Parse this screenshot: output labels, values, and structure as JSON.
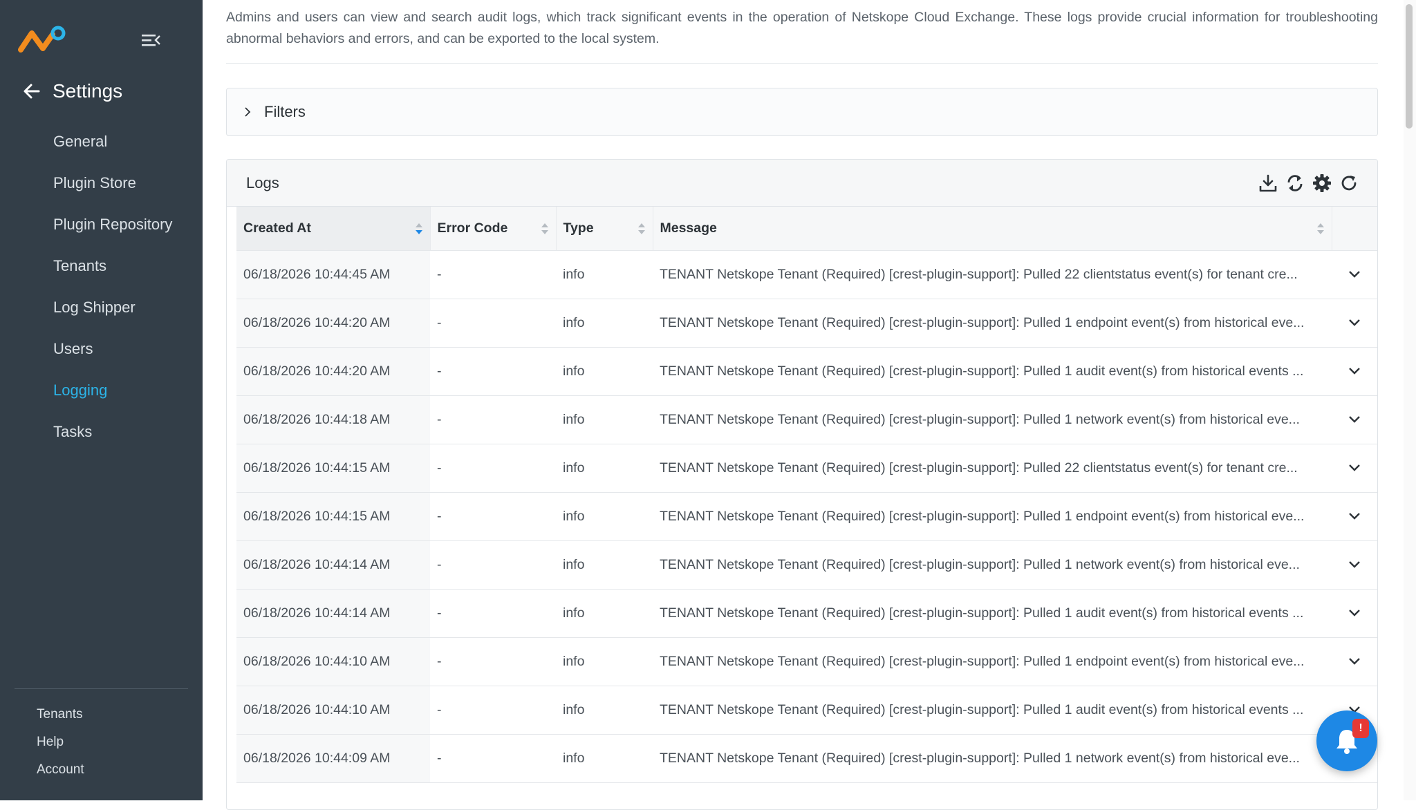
{
  "sidebar": {
    "settings_title": "Settings",
    "nav_items": [
      {
        "label": "General"
      },
      {
        "label": "Plugin Store"
      },
      {
        "label": "Plugin Repository"
      },
      {
        "label": "Tenants"
      },
      {
        "label": "Log Shipper"
      },
      {
        "label": "Users"
      },
      {
        "label": "Logging",
        "active": true
      },
      {
        "label": "Tasks"
      }
    ],
    "footer_items": [
      {
        "label": "Tenants"
      },
      {
        "label": "Help"
      },
      {
        "label": "Account"
      }
    ]
  },
  "description": "Admins and users can view and search audit logs, which track significant events in the operation of Netskope Cloud Exchange. These logs provide crucial information for troubleshooting abnormal behaviors and errors, and can be exported to the local system.",
  "filters": {
    "label": "Filters"
  },
  "logs": {
    "title": "Logs",
    "toolbar": [
      "download-icon",
      "sync-icon",
      "gear-icon",
      "refresh-icon"
    ],
    "columns": {
      "created_at": "Created At",
      "error_code": "Error Code",
      "type": "Type",
      "message": "Message"
    },
    "rows": [
      {
        "created_at": "06/18/2026 10:44:45 AM",
        "error_code": "-",
        "type": "info",
        "message": "TENANT Netskope Tenant (Required) [crest-plugin-support]: Pulled 22 clientstatus event(s) for tenant cre..."
      },
      {
        "created_at": "06/18/2026 10:44:20 AM",
        "error_code": "-",
        "type": "info",
        "message": "TENANT Netskope Tenant (Required) [crest-plugin-support]: Pulled 1 endpoint event(s) from historical eve..."
      },
      {
        "created_at": "06/18/2026 10:44:20 AM",
        "error_code": "-",
        "type": "info",
        "message": "TENANT Netskope Tenant (Required) [crest-plugin-support]: Pulled 1 audit event(s) from historical events ..."
      },
      {
        "created_at": "06/18/2026 10:44:18 AM",
        "error_code": "-",
        "type": "info",
        "message": "TENANT Netskope Tenant (Required) [crest-plugin-support]: Pulled 1 network event(s) from historical eve..."
      },
      {
        "created_at": "06/18/2026 10:44:15 AM",
        "error_code": "-",
        "type": "info",
        "message": "TENANT Netskope Tenant (Required) [crest-plugin-support]: Pulled 22 clientstatus event(s) for tenant cre..."
      },
      {
        "created_at": "06/18/2026 10:44:15 AM",
        "error_code": "-",
        "type": "info",
        "message": "TENANT Netskope Tenant (Required) [crest-plugin-support]: Pulled 1 endpoint event(s) from historical eve..."
      },
      {
        "created_at": "06/18/2026 10:44:14 AM",
        "error_code": "-",
        "type": "info",
        "message": "TENANT Netskope Tenant (Required) [crest-plugin-support]: Pulled 1 network event(s) from historical eve..."
      },
      {
        "created_at": "06/18/2026 10:44:14 AM",
        "error_code": "-",
        "type": "info",
        "message": "TENANT Netskope Tenant (Required) [crest-plugin-support]: Pulled 1 audit event(s) from historical events ..."
      },
      {
        "created_at": "06/18/2026 10:44:10 AM",
        "error_code": "-",
        "type": "info",
        "message": "TENANT Netskope Tenant (Required) [crest-plugin-support]: Pulled 1 endpoint event(s) from historical eve..."
      },
      {
        "created_at": "06/18/2026 10:44:10 AM",
        "error_code": "-",
        "type": "info",
        "message": "TENANT Netskope Tenant (Required) [crest-plugin-support]: Pulled 1 audit event(s) from historical events ..."
      },
      {
        "created_at": "06/18/2026 10:44:09 AM",
        "error_code": "-",
        "type": "info",
        "message": "TENANT Netskope Tenant (Required) [crest-plugin-support]: Pulled 1 network event(s) from historical eve..."
      }
    ]
  },
  "notification": {
    "badge": "!"
  },
  "colors": {
    "sidebar_bg": "#333e48",
    "active_nav": "#2cb4e8",
    "fab": "#1e88e5",
    "badge": "#e53935"
  }
}
